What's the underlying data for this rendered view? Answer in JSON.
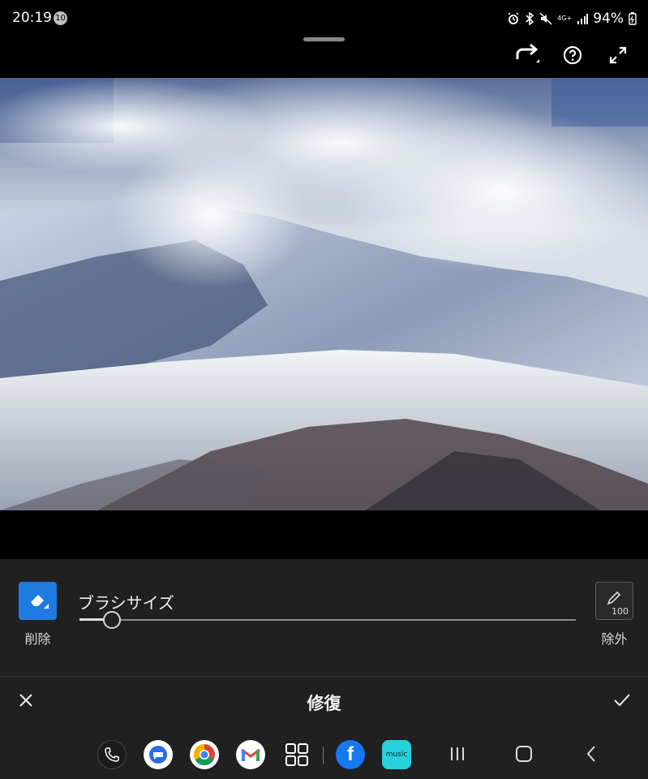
{
  "status_bar": {
    "time": "20:19",
    "notification_count": "10",
    "network": "4G+",
    "battery": "94%"
  },
  "icons": {
    "share": "redo-arrow-icon",
    "help": "help-circle-icon",
    "fullscreen": "expand-icon",
    "erase": "eraser-icon",
    "exclude": "pencil-icon",
    "close": "close-icon",
    "confirm": "check-icon"
  },
  "editor": {
    "erase_label": "削除",
    "brush_size_label": "ブラシサイズ",
    "brush_size_value": 7,
    "exclude_label": "除外",
    "exclude_value": "100",
    "title": "修復"
  },
  "dock": {
    "apps": [
      "phone",
      "messages",
      "chrome",
      "gmail",
      "app-drawer",
      "facebook",
      "amazon-music"
    ],
    "amazon_music_text": "music"
  },
  "colors": {
    "accent": "#1f7be0",
    "panel_bg": "#202020"
  }
}
